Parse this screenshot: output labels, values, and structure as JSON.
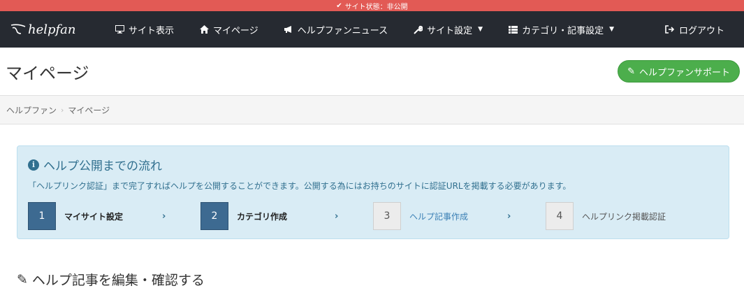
{
  "status_bar": {
    "text": "サイト状態：非公開"
  },
  "navbar": {
    "logo_text": "helpfan",
    "items": [
      {
        "label": "サイト表示",
        "icon": "monitor-icon"
      },
      {
        "label": "マイページ",
        "icon": "home-icon"
      },
      {
        "label": "ヘルプファンニュース",
        "icon": "megaphone-icon"
      },
      {
        "label": "サイト設定",
        "icon": "wrench-icon",
        "dropdown": true
      },
      {
        "label": "カテゴリ・記事設定",
        "icon": "list-icon",
        "dropdown": true
      }
    ],
    "logout_label": "ログアウト"
  },
  "page_header": {
    "title": "マイページ",
    "support_label": "ヘルプファンサポート"
  },
  "breadcrumb": {
    "items": [
      "ヘルプファン",
      "マイページ"
    ]
  },
  "info_panel": {
    "title": "ヘルプ公開までの流れ",
    "description": "「ヘルプリンク認証」まで完了すればヘルプを公開することができます。公開する為にはお持ちのサイトに認証URLを掲載する必要があります。",
    "steps": [
      {
        "number": "1",
        "label": "マイサイト設定",
        "state": "done"
      },
      {
        "number": "2",
        "label": "カテゴリ作成",
        "state": "done"
      },
      {
        "number": "3",
        "label": "ヘルプ記事作成",
        "state": "current"
      },
      {
        "number": "4",
        "label": "ヘルプリンク掲載認証",
        "state": "todo"
      }
    ]
  },
  "section": {
    "title": "ヘルプ記事を編集・確認する"
  },
  "colors": {
    "status_bar": "#e25a55",
    "navbar": "#262a31",
    "success": "#4cae4c",
    "info_bg": "#d9ecf5",
    "step_done": "#3d6a91"
  }
}
